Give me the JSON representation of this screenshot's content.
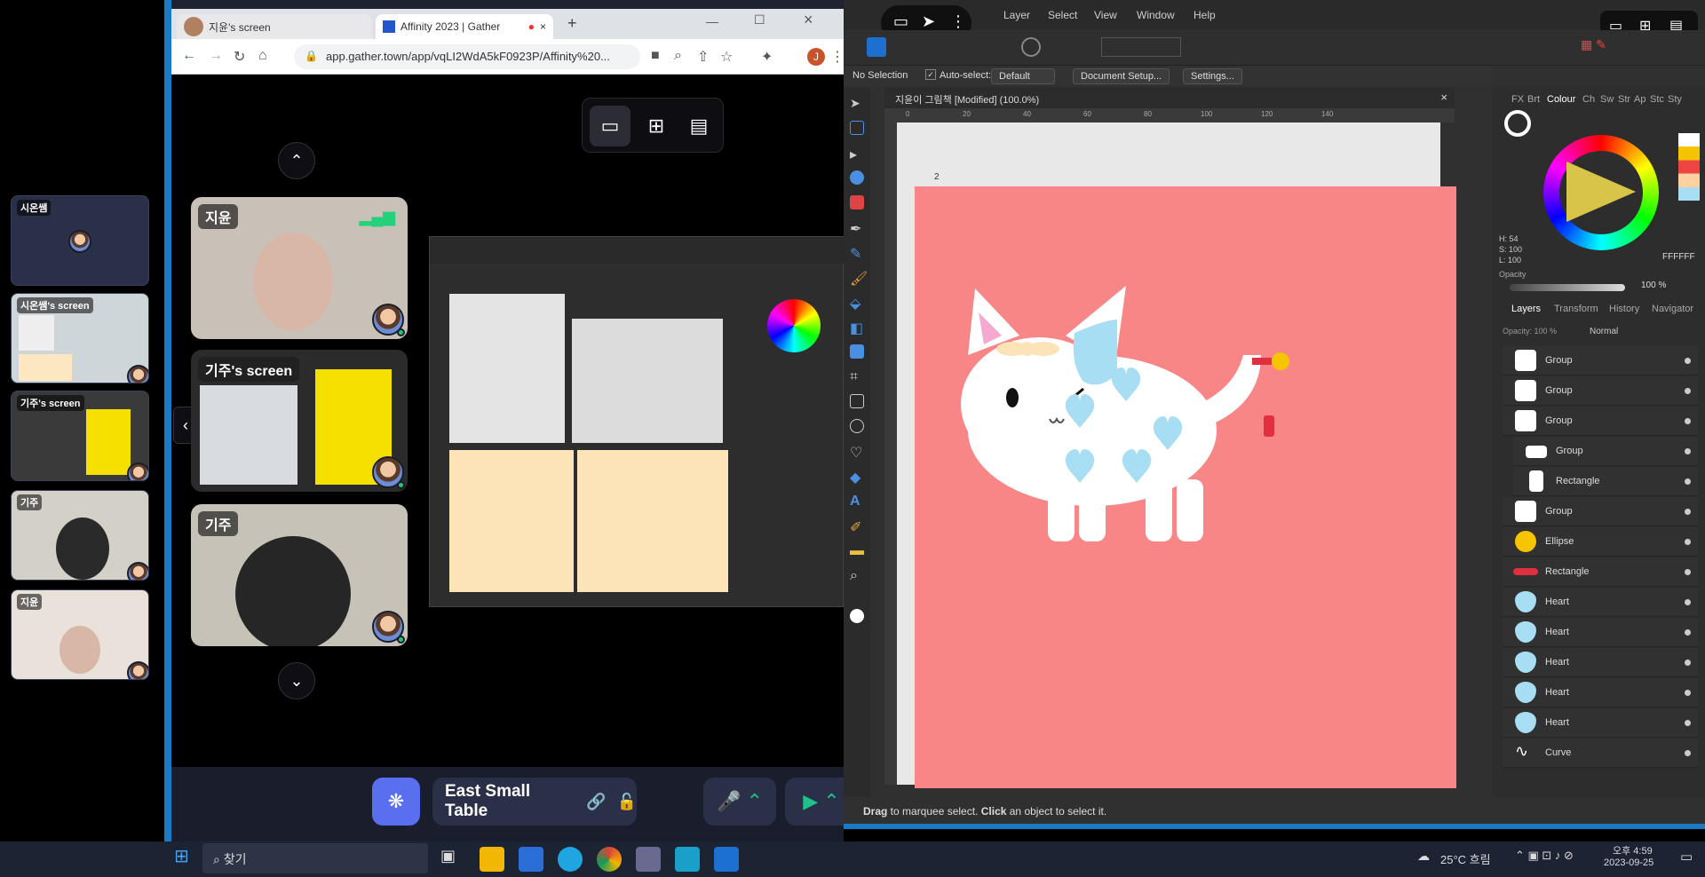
{
  "left_strip": {
    "tiles": [
      {
        "label": "시온쌤"
      },
      {
        "label": "시온쌤's screen"
      },
      {
        "label": "기주's screen"
      },
      {
        "label": "기주"
      },
      {
        "label": "지윤"
      }
    ]
  },
  "browser": {
    "tabs": [
      {
        "label": "지윤's screen"
      },
      {
        "label": "Affinity 2023 | Gather"
      }
    ],
    "new_tab": "+",
    "url": "app.gather.town/app/vqLI2WdA5kF0923P/Affinity%20...",
    "profile_initial": "J"
  },
  "gather": {
    "videos": [
      {
        "name": "지윤"
      },
      {
        "name": "기주's screen"
      },
      {
        "name": "기주"
      }
    ],
    "location": "East Small Table",
    "view_icons": [
      "monitor-icon",
      "grid-icon",
      "map-icon"
    ]
  },
  "affinity": {
    "menu": [
      "Layer",
      "Select",
      "View",
      "Window",
      "Help"
    ],
    "context": {
      "no_selection": "No Selection",
      "auto_select_label": "Auto-select:",
      "auto_select_value": "Default",
      "doc_setup": "Document Setup...",
      "settings": "Settings..."
    },
    "doc_title": "지윤이 그림책 [Modified] (100.0%)",
    "artboard_number": "2",
    "ruler_marks": [
      "0",
      "20",
      "40",
      "60",
      "80",
      "100",
      "120",
      "140"
    ],
    "panel_tabs_top": [
      "FX",
      "Brt",
      "Colour",
      "Ch",
      "Sw",
      "Str",
      "Ap",
      "Stc",
      "Sty"
    ],
    "colour": {
      "h": "H: 54",
      "s": "S: 100",
      "l": "L: 100",
      "hex": "FFFFFF",
      "opacity_label": "Opacity",
      "opacity_value": "100 %"
    },
    "panel_tabs_layers": [
      "Layers",
      "Transform",
      "History",
      "Navigator"
    ],
    "layers_opacity": "Opacity: 100 %",
    "blend": "Normal",
    "layers": [
      {
        "name": "Group"
      },
      {
        "name": "Group"
      },
      {
        "name": "Group"
      },
      {
        "name": "Group"
      },
      {
        "name": "Rectangle"
      },
      {
        "name": "Group"
      },
      {
        "name": "Ellipse"
      },
      {
        "name": "Rectangle"
      },
      {
        "name": "Heart"
      },
      {
        "name": "Heart"
      },
      {
        "name": "Heart"
      },
      {
        "name": "Heart"
      },
      {
        "name": "Heart"
      },
      {
        "name": "Curve"
      }
    ],
    "status_bold1": "Drag",
    "status_text1": " to marquee select. ",
    "status_bold2": "Click",
    "status_text2": " an object to select it."
  },
  "taskbar": {
    "search": "찾기",
    "weather": "25°C 흐림",
    "time": "오후 4:59",
    "date": "2023-09-25"
  },
  "colors": {
    "artboard": "#f98686",
    "gather_bg": "#1a1d2c",
    "accent": "#1a7ac4"
  }
}
